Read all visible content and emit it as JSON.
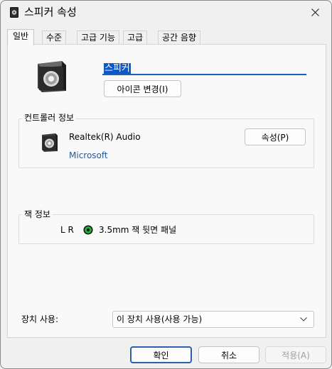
{
  "window": {
    "title": "스피커 속성",
    "close_label": ""
  },
  "tabs": [
    {
      "label": "일반",
      "active": true
    },
    {
      "label": "수준",
      "active": false
    },
    {
      "label": "고급 기능",
      "active": false
    },
    {
      "label": "고급",
      "active": false
    },
    {
      "label": "공간 음향",
      "active": false
    }
  ],
  "general": {
    "device_name": "스피커",
    "change_icon_label": "아이콘 변경(I)"
  },
  "controller": {
    "group_title": "컨트롤러 정보",
    "name": "Realtek(R) Audio",
    "vendor": "Microsoft",
    "properties_label": "속성(P)"
  },
  "jack": {
    "group_title": "잭 정보",
    "channels": "L R",
    "color": "#1fb53a",
    "description": "3.5mm 잭 뒷면 패널"
  },
  "device_usage": {
    "label": "장치 사용:",
    "selected": "이 장치 사용(사용 가능)"
  },
  "footer": {
    "ok_label": "확인",
    "cancel_label": "취소",
    "apply_label": "적용(A)"
  }
}
